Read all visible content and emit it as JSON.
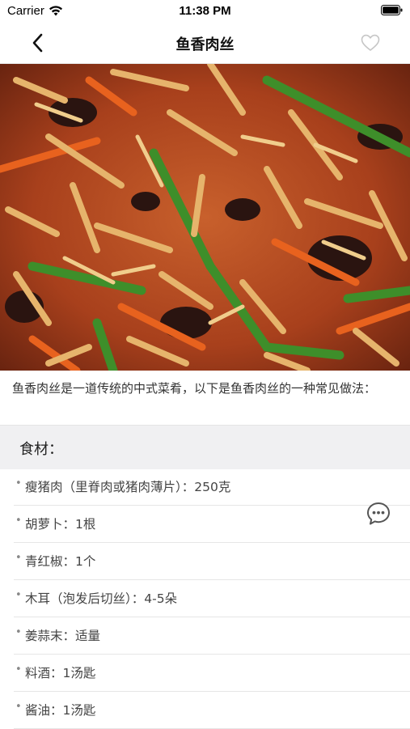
{
  "status_bar": {
    "carrier": "Carrier",
    "time": "11:38 PM"
  },
  "nav": {
    "title": "鱼香肉丝",
    "back_icon": "chevron-left-icon",
    "favorite_icon": "heart-outline-icon"
  },
  "hero_image": {
    "subject": "fish-fragrant-shredded-pork-dish-photo"
  },
  "intro": "鱼香肉丝是一道传统的中式菜肴，以下是鱼香肉丝的一种常见做法：",
  "ingredients_section": {
    "title": "食材：",
    "items": [
      "瘦猪肉（里脊肉或猪肉薄片）：250克",
      "胡萝卜：1根",
      "青红椒：1个",
      "木耳（泡发后切丝）：4-5朵",
      "姜蒜末：适量",
      "料酒：1汤匙",
      "酱油：1汤匙"
    ]
  },
  "colors": {
    "accent_text": "#111111",
    "section_bg": "#f0f0f2",
    "divider": "#e6e6e6"
  }
}
